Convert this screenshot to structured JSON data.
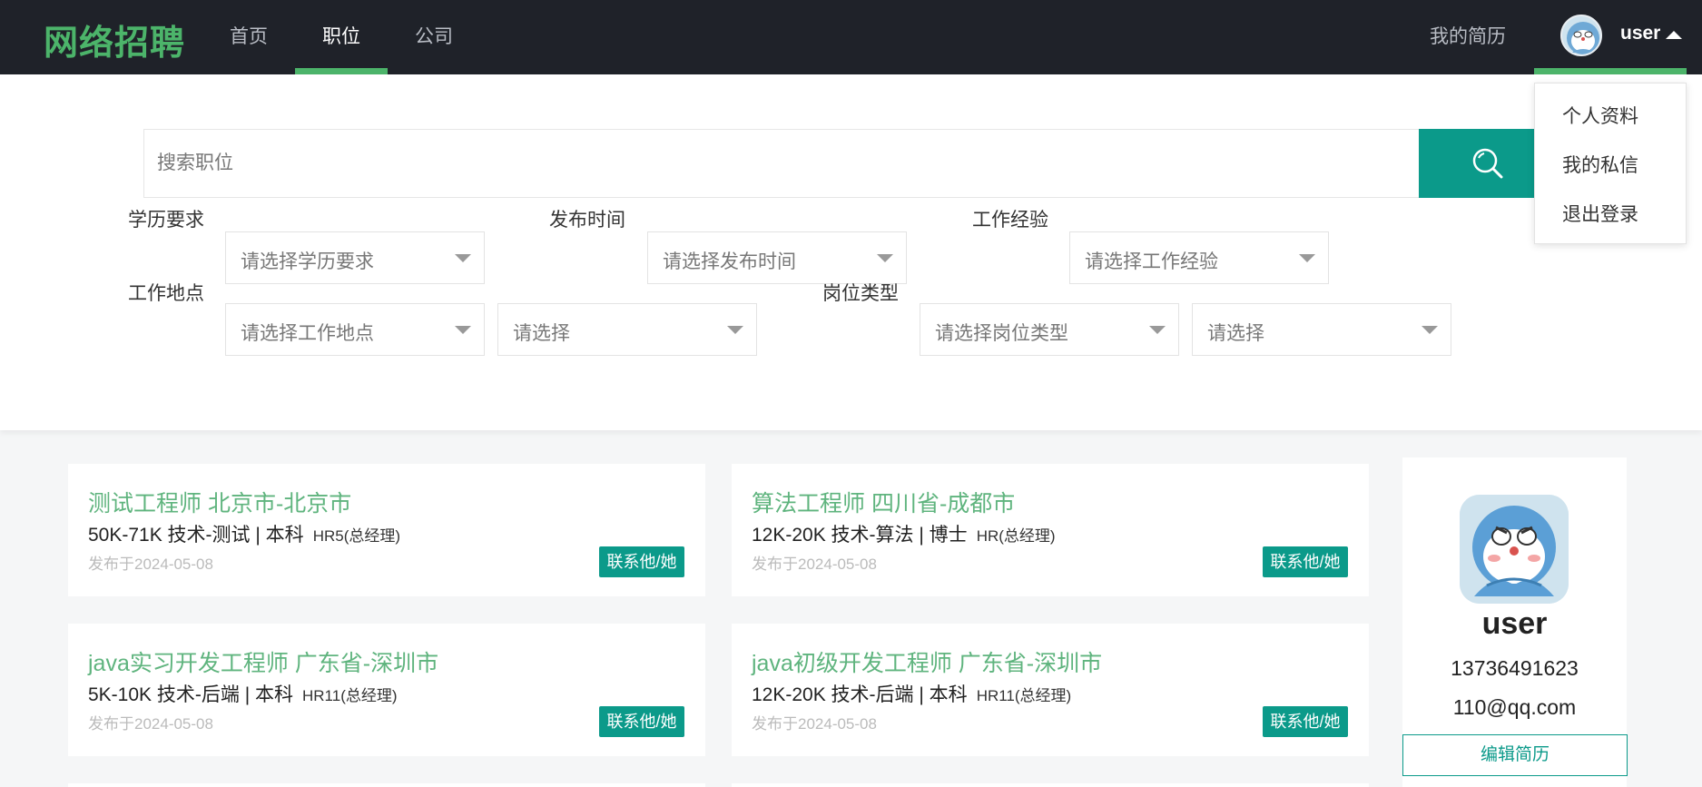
{
  "header": {
    "logo": "网络招聘",
    "nav": [
      "首页",
      "职位",
      "公司"
    ],
    "resume_link": "我的简历",
    "user_name": "user"
  },
  "dropdown": {
    "items": [
      "个人资料",
      "我的私信",
      "退出登录"
    ]
  },
  "search": {
    "placeholder": "搜索职位"
  },
  "filters": {
    "education": {
      "label": "学历要求",
      "placeholder": "请选择学历要求"
    },
    "publish_time": {
      "label": "发布时间",
      "placeholder": "请选择发布时间"
    },
    "experience": {
      "label": "工作经验",
      "placeholder": "请选择工作经验"
    },
    "location": {
      "label": "工作地点",
      "placeholder": "请选择工作地点",
      "sub_placeholder": "请选择"
    },
    "job_type": {
      "label": "岗位类型",
      "placeholder": "请选择岗位类型",
      "sub_placeholder": "请选择"
    }
  },
  "jobs": [
    {
      "title": "测试工程师  北京市-北京市",
      "info": "50K-71K  技术-测试 | 本科",
      "hr": "HR5(总经理)",
      "date": "发布于2024-05-08",
      "contact": "联系他/她"
    },
    {
      "title": "算法工程师  四川省-成都市",
      "info": "12K-20K  技术-算法 | 博士",
      "hr": "HR(总经理)",
      "date": "发布于2024-05-08",
      "contact": "联系他/她"
    },
    {
      "title": "java实习开发工程师  广东省-深圳市",
      "info": "5K-10K  技术-后端 | 本科",
      "hr": "HR11(总经理)",
      "date": "发布于2024-05-08",
      "contact": "联系他/她"
    },
    {
      "title": "java初级开发工程师  广东省-深圳市",
      "info": "12K-20K  技术-后端 | 本科",
      "hr": "HR11(总经理)",
      "date": "发布于2024-05-08",
      "contact": "联系他/她"
    }
  ],
  "profile": {
    "name": "user",
    "phone": "13736491623",
    "email": "110@qq.com",
    "edit_label": "编辑简历"
  },
  "colors": {
    "header_bg": "#1f2229",
    "accent_green": "#4cb46a",
    "teal": "#0b9a8a"
  }
}
